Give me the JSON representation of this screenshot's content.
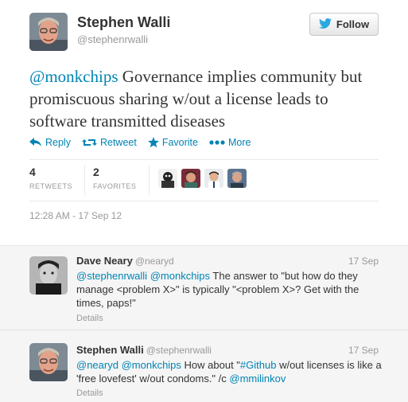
{
  "author": {
    "name": "Stephen Walli",
    "handle": "@stephenrwalli"
  },
  "follow_button": {
    "label": "Follow"
  },
  "tweet": {
    "mention": "@monkchips",
    "text": " Governance implies community but promiscuous sharing w/out a license leads to software transmitted diseases"
  },
  "actions": {
    "reply": "Reply",
    "retweet": "Retweet",
    "favorite": "Favorite",
    "more": "More"
  },
  "stats": {
    "retweets_count": "4",
    "retweets_label": "RETWEETS",
    "favorites_count": "2",
    "favorites_label": "FAVORITES"
  },
  "timestamp": "12:28 AM - 17 Sep 12",
  "replies": [
    {
      "name": "Dave Neary",
      "handle": "@nearyd",
      "date": "17 Sep",
      "mention1": "@stephenrwalli",
      "mention2": "@monkchips",
      "text": " The answer to \"but how do they manage <problem X>\" is typically \"<problem X>? Get with the times, paps!\"",
      "details": "Details"
    },
    {
      "name": "Stephen Walli",
      "handle": "@stephenrwalli",
      "date": "17 Sep",
      "mention1": "@nearyd",
      "mention2": "@monkchips",
      "text_a": " How about \"",
      "hashtag": "#Github",
      "text_b": " w/out licenses is like a 'free lovefest' w/out condoms.\" /c ",
      "mention3": "@mmilinkov",
      "details": "Details"
    }
  ],
  "colors": {
    "link": "#0084b4",
    "twitter_bird": "#2aa9e0"
  },
  "icons": [
    "twitter-bird-icon",
    "reply-icon",
    "retweet-icon",
    "favorite-star-icon",
    "more-dots-icon"
  ]
}
